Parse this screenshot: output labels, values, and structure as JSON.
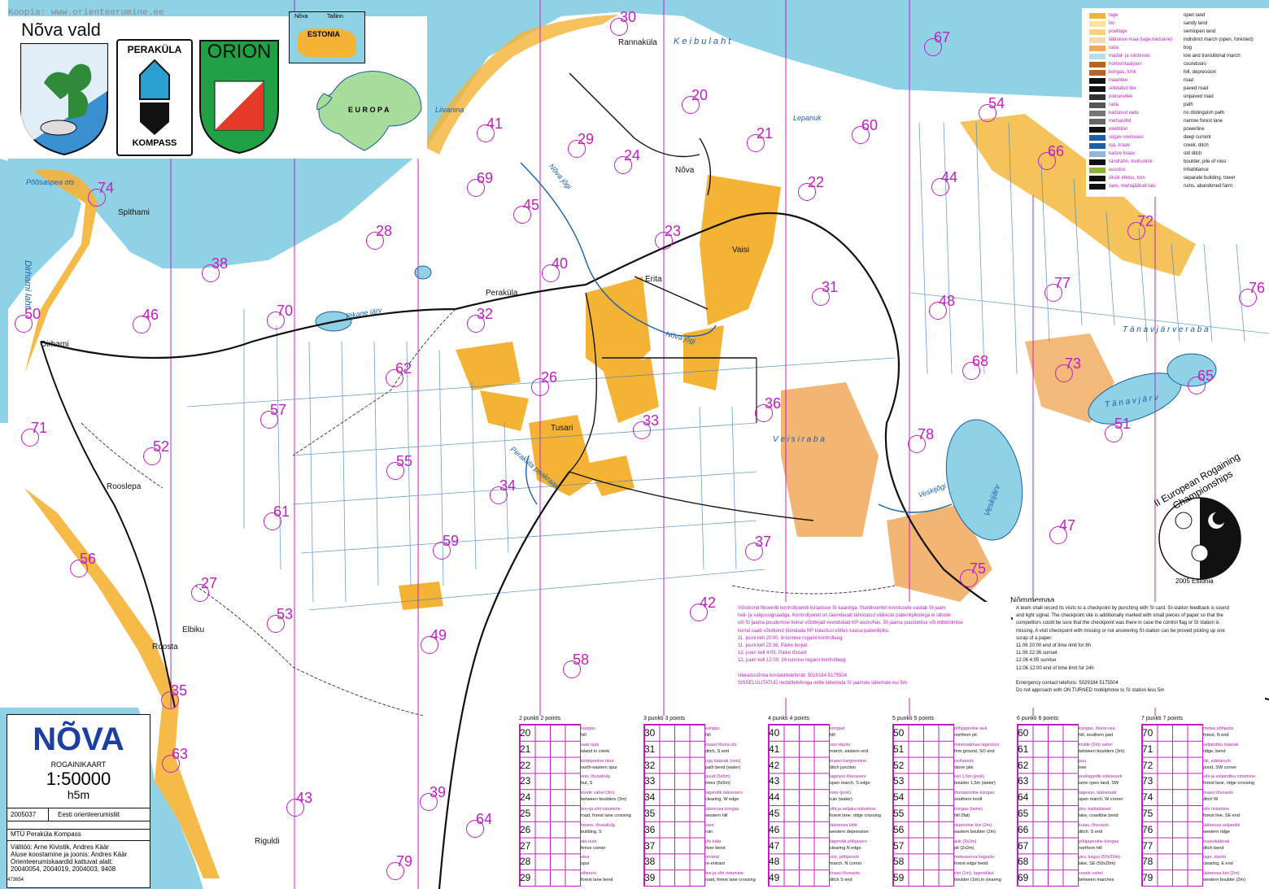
{
  "header_text": "Koopia: www.orienteerumine.ee",
  "logos": {
    "municipality_title": "Nõva vald",
    "club_top": "PERAKÜLA",
    "club_bottom": "KOMPASS",
    "orion": "ORION"
  },
  "inset": {
    "tallinn": "Tallinn",
    "nova": "Nõva",
    "estonia": "ESTONIA",
    "europa": "E U R O P A"
  },
  "place_names": [
    {
      "id": "rannakula",
      "text": "Rannaküla"
    },
    {
      "id": "nova",
      "text": "Nõva"
    },
    {
      "id": "vaisi",
      "text": "Vaisi"
    },
    {
      "id": "erita",
      "text": "Erita"
    },
    {
      "id": "perakula",
      "text": "Peraküla"
    },
    {
      "id": "tusari",
      "text": "Tusari"
    },
    {
      "id": "spithami",
      "text": "Spithami"
    },
    {
      "id": "dirhami",
      "text": "Dirhami"
    },
    {
      "id": "rooslepa",
      "text": "Rooslepa"
    },
    {
      "id": "elbiku",
      "text": "Elbiku"
    },
    {
      "id": "roosta",
      "text": "Roosta"
    },
    {
      "id": "riguldi",
      "text": "Riguldi"
    },
    {
      "id": "nommemaa",
      "text": "Nõmmemaa"
    }
  ],
  "water_names": [
    {
      "id": "keibu",
      "text": "K e i b u   l a h t"
    },
    {
      "id": "liivanina",
      "text": "Liivanina"
    },
    {
      "id": "poosaspea",
      "text": "Põõsaspea ots"
    },
    {
      "id": "dirhami-laht",
      "text": "Dirhami  laht"
    },
    {
      "id": "pikane",
      "text": "Pikane järv"
    },
    {
      "id": "nova-jogi",
      "text": "Nõva jõgi"
    },
    {
      "id": "nova-jogi2",
      "text": "Nõva jõgi"
    },
    {
      "id": "lepanuk",
      "text": "Lepanuk"
    },
    {
      "id": "peraklla-peakraav",
      "text": "Peraküla peakraav"
    },
    {
      "id": "tanavjarve-raba",
      "text": "T ä n a v j ä r v e   r a b a"
    },
    {
      "id": "tanavjarv",
      "text": "T ä n a v j ä r v"
    },
    {
      "id": "veisi-raba",
      "text": "V e i s i   r a b a"
    },
    {
      "id": "veskijarv",
      "text": "Veskijärv"
    },
    {
      "id": "veskijogi",
      "text": "Veskijõgi"
    }
  ],
  "checkpoints": [
    "20",
    "21",
    "22",
    "23",
    "24",
    "26",
    "27",
    "28",
    "29",
    "30",
    "31",
    "32",
    "33",
    "34",
    "35",
    "36",
    "37",
    "38",
    "39",
    "40",
    "41",
    "42",
    "43",
    "44",
    "45",
    "46",
    "47",
    "48",
    "49",
    "50",
    "51",
    "52",
    "53",
    "54",
    "55",
    "56",
    "57",
    "58",
    "59",
    "60",
    "61",
    "62",
    "63",
    "64",
    "65",
    "66",
    "67",
    "68",
    "69",
    "70",
    "71",
    "72",
    "73",
    "74",
    "75",
    "76",
    "77",
    "78",
    "79"
  ],
  "legend": [
    {
      "et": "lage",
      "en": "open land"
    },
    {
      "et": "liiv",
      "en": "sandy land"
    },
    {
      "et": "poollage",
      "en": "semiopen land"
    },
    {
      "et": "läbiskive maa (lage,metsane)",
      "en": "indistinct march (open, forested)"
    },
    {
      "et": "raba",
      "en": "bog"
    },
    {
      "et": "madal- ja siirdesoo",
      "en": "low and transitional march"
    },
    {
      "et": "horisontaaljoon",
      "en": "coundours"
    },
    {
      "et": "küngas, lohk",
      "en": "hill, depression"
    },
    {
      "et": "maantee",
      "en": "road"
    },
    {
      "et": "sillutatud tee",
      "en": "paved road"
    },
    {
      "et": "pinnasetee",
      "en": "unpaved road"
    },
    {
      "et": "rada",
      "en": "path"
    },
    {
      "et": "kadunud rada",
      "en": "no distinguish path"
    },
    {
      "et": "metsasihd",
      "en": "narrow forest lane"
    },
    {
      "et": "elektriliin",
      "en": "powerline"
    },
    {
      "et": "sügav vooluvesi",
      "en": "deep current"
    },
    {
      "et": "oja, kraav",
      "en": "creek, ditch"
    },
    {
      "et": "kaduv kraav",
      "en": "old ditch"
    },
    {
      "et": "rändrahn, kivihunnik",
      "en": "boulder, pile of roos"
    },
    {
      "et": "asustus",
      "en": "inhabitance"
    },
    {
      "et": "üksik ehitus, torn",
      "en": "separate building, tower"
    },
    {
      "et": "vare, mahajäätud talu",
      "en": "ruins, abandoned farm"
    }
  ],
  "event_logo": {
    "arc_text": "II European Rogaining Championships",
    "bottom": "2005 Estonia"
  },
  "notes_et": [
    "Võistkond fikseerib kontrollpunkti külastuse SI kaardiga. Stardinumbri kinnitusele vastab SI-jaam",
    "heli- ja valgussignaaliga. Kontrollpunkt on täiendavalt tähistatud väikeste paberilipikutega ei tähiste",
    "või SI jaama puudumise korral võistlejad veendukad KP asukohas. SI-jaama puudumise või mittetoimise",
    "korral saab võistkond tõendada KP külastusi võttes kaasa paberilipiku.",
    "11. juuni kell 20:00. 8-tunnise rogaini kontrollaeg",
    "11. juuni kell 22:36. Päike loojub",
    "12. juuni kell 4:05. Päike tõuseb",
    "12. juuni kell 12:00. 24-tunnise rogaini kontrollaeg",
    "",
    "Häiradusõnna kontaktitelefonid: 5029184  5175504",
    "SISSELÜLITATUD mobiiltelefonga mitte läheneda SI jaamale lähemale kui 5m"
  ],
  "notes_en": [
    "A team shall record its visits to a checkpoint by punching with SI card. SI-station feedback is sound",
    "and light signal. The checkpoint site is additionally marked with small pieces of paper so that the",
    "competitors could be sure that the checkpoint was there in case the control flag or SI station is",
    "missing. A visit checkpoint with missing or not answering SI-station can be proved picking up one",
    "scrap of a paper.",
    "11.06  20:00   end of time limit for 8h",
    "11.06  22:36   sunset",
    "12.06   4:05    sunrise",
    "12.06  12:00   end of time limit for 24h",
    "",
    "Emergency contact telefons: 5029184  5175504",
    "Do not approach with ON TURNED mobilphone to SI station less 5m"
  ],
  "title_block": {
    "title": "NÕVA",
    "subtitle": "ROGAINIKAART",
    "scale": "1:50000",
    "contour": "h5m",
    "code": "2005037",
    "federation": "Eesti orienteerumisliit",
    "club": "MTÜ Peraküla Kompass",
    "credits": [
      "Välitöö: Arne Kivistik, Andres Käär",
      "Aluse koostamine ja joonis: Andres Käär",
      "Orienteerumiskaardid kattuvat alalt:",
      "20040054, 2004019, 2004003, 9408"
    ],
    "serial": "473654"
  },
  "control_descriptions": [
    {
      "group": "2 punkti 2 points",
      "rows": [
        {
          "n": "20",
          "et": "küngas",
          "en": "hill"
        },
        {
          "n": "21",
          "et": "saar ojas",
          "en": "island in creek"
        },
        {
          "n": "22",
          "et": "kirdepoolne nina",
          "en": "north-eastern spur"
        },
        {
          "n": "23",
          "et": "onn, lõunakülg",
          "en": "hut, S"
        },
        {
          "n": "24",
          "et": "kivide vahel (3m)",
          "en": "between boulders (3m)"
        },
        {
          "n": "25",
          "et": "tee+ja sihi ristumine",
          "en": "road, forest lane crossing"
        },
        {
          "n": "26",
          "et": "hoone, lõunakülg",
          "en": "building, S"
        },
        {
          "n": "27",
          "et": "aia nurk",
          "en": "fence corner"
        },
        {
          "n": "28",
          "et": "nina",
          "en": "spur"
        },
        {
          "n": "29",
          "et": "sihinurk",
          "en": "forest lane bend"
        }
      ]
    },
    {
      "group": "3 punkti 3 points",
      "rows": [
        {
          "n": "30",
          "et": "küngas",
          "en": "hill"
        },
        {
          "n": "31",
          "et": "kraavi lõuna ots",
          "en": "ditch, S end"
        },
        {
          "n": "32",
          "et": "raja käänak (vesi)",
          "en": "path bend (water)"
        },
        {
          "n": "33",
          "et": "puud (5x5m)",
          "en": "trees (5x5m)"
        },
        {
          "n": "34",
          "et": "lagendik lääneserv",
          "en": "clearing, W edge"
        },
        {
          "n": "35",
          "et": "lääneosa küngas",
          "en": "western hill"
        },
        {
          "n": "36",
          "et": "vare",
          "en": "ruin"
        },
        {
          "n": "37",
          "et": "jõe käär",
          "en": "river bend"
        },
        {
          "n": "38",
          "et": "orvand",
          "en": "re-entrant"
        },
        {
          "n": "39",
          "et": "tee ja sihi ristumine",
          "en": "road, forest lane crossing"
        }
      ]
    },
    {
      "group": "4 punkti 4 points",
      "rows": [
        {
          "n": "40",
          "et": "küngad",
          "en": "hill"
        },
        {
          "n": "41",
          "et": "soo idaots",
          "en": "march, eastern end"
        },
        {
          "n": "42",
          "et": "kraavi hargnemine",
          "en": "ditch junction"
        },
        {
          "n": "43",
          "et": "lagesoo lõunaserv",
          "en": "open march, S edge"
        },
        {
          "n": "44",
          "et": "vare (jook)",
          "en": "ruin (water)"
        },
        {
          "n": "45",
          "et": "sihi ja seljaku ristumine",
          "en": "forest lane, ridge crossing"
        },
        {
          "n": "46",
          "et": "lääneosa lohk",
          "en": "western depression"
        },
        {
          "n": "47",
          "et": "lagendik põhjaserv",
          "en": "clearing N edge"
        },
        {
          "n": "48",
          "et": "soo, põhjanurk",
          "en": "march, N corner"
        },
        {
          "n": "49",
          "et": "kraavi lõunaots",
          "en": "ditch S end"
        }
      ]
    },
    {
      "group": "5 punkti 5 points",
      "rows": [
        {
          "n": "50",
          "et": "põhjapoolne auk",
          "en": "northern pit"
        },
        {
          "n": "51",
          "et": "mineraalmaa lagesoos",
          "en": "firm ground, SO end"
        },
        {
          "n": "52",
          "et": "kivihunnik",
          "en": "stone pile"
        },
        {
          "n": "53",
          "et": "kivi 1,5m (jook)",
          "en": "boulder 1,5m (water)"
        },
        {
          "n": "54",
          "et": "lõunapoolne küngas",
          "en": "southern knoll"
        },
        {
          "n": "55",
          "et": "küngas (lame)",
          "en": "hill (flat)"
        },
        {
          "n": "56",
          "et": "idapoolne kivi (2m)",
          "en": "eastern boulder (2m)"
        },
        {
          "n": "57",
          "et": "auk (2x2m)",
          "en": "pit (2x2m)"
        },
        {
          "n": "58",
          "et": "metsaserva kaguots",
          "en": "forest edge bend"
        },
        {
          "n": "59",
          "et": "kivi (1m), lagendikul",
          "en": "boulder (1m),in clearing"
        }
      ]
    },
    {
      "group": "6 punkti 6 points",
      "rows": [
        {
          "n": "60",
          "et": "küngas, lõuna osa",
          "en": "hill, southern part"
        },
        {
          "n": "61",
          "et": "kivide (3m) vahel",
          "en": "between boulders (3m)"
        },
        {
          "n": "62",
          "et": "puu",
          "en": "tree"
        },
        {
          "n": "63",
          "et": "poollagedik edelanurk",
          "en": "semi open land, SW"
        },
        {
          "n": "64",
          "et": "lagesoo, läänenurk",
          "en": "open march, W corner"
        },
        {
          "n": "65",
          "et": "järv, kaldaäärsel",
          "en": "lake, coastline bend"
        },
        {
          "n": "66",
          "et": "kraav, lõunaots",
          "en": "ditch, S end"
        },
        {
          "n": "67",
          "et": "põhjapoolne küngas",
          "en": "northern hill"
        },
        {
          "n": "68",
          "et": "järv, kagus (50x20m)",
          "en": "lake, SE (50x20m)"
        },
        {
          "n": "69",
          "et": "soode vahel",
          "en": "between marches"
        }
      ]
    },
    {
      "group": "7 punkti 7 points",
      "rows": [
        {
          "n": "70",
          "et": "metsa põhjaots",
          "en": "forest, N end"
        },
        {
          "n": "71",
          "et": "seljandiku käänak",
          "en": "ridge, bend"
        },
        {
          "n": "72",
          "et": "tiik, edelanurk",
          "en": "pond, SW corner"
        },
        {
          "n": "73",
          "et": "sihi ja seljandiku ristumine",
          "en": "forest lane, ridge crossing"
        },
        {
          "n": "74",
          "et": "kraavi lõunaots",
          "en": "ditch W"
        },
        {
          "n": "75",
          "et": "sihi ristumine",
          "en": "forest line, SE end"
        },
        {
          "n": "76",
          "et": "lääneosa seljandik",
          "en": "western ridge"
        },
        {
          "n": "77",
          "et": "kraavikäänak",
          "en": "ditch bend"
        },
        {
          "n": "78",
          "et": "lage, idaots",
          "en": "clearing, E end"
        },
        {
          "n": "79",
          "et": "lääneosa kivi (2m)",
          "en": "western boulder (2m)"
        }
      ]
    }
  ]
}
